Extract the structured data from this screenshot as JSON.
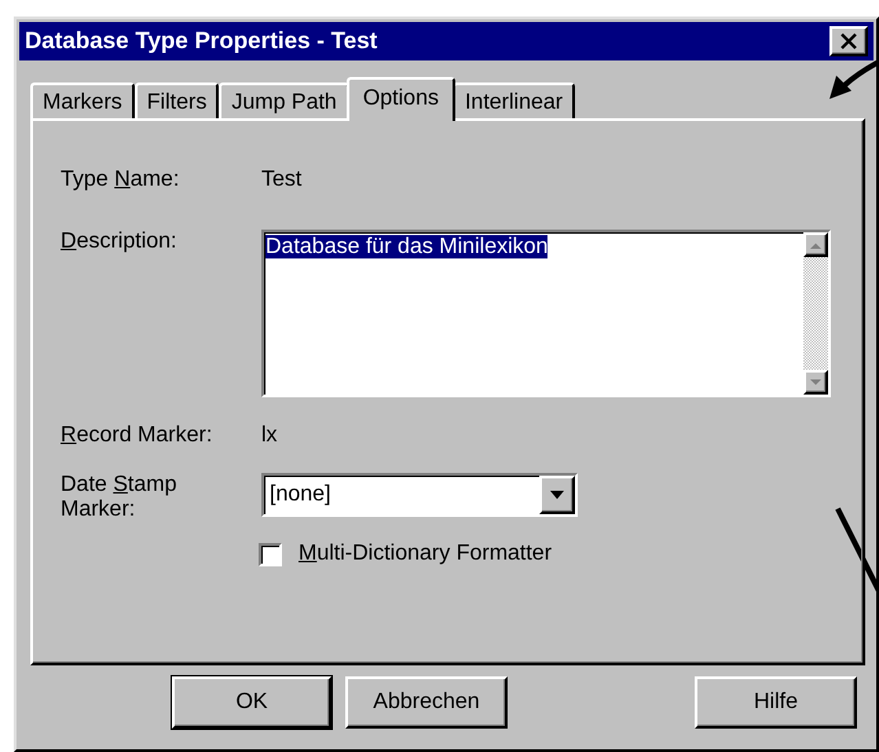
{
  "window": {
    "title": "Database Type Properties - Test"
  },
  "tabs": [
    {
      "label": "Markers",
      "selected": false
    },
    {
      "label": "Filters",
      "selected": false
    },
    {
      "label": "Jump Path",
      "selected": false
    },
    {
      "label": "Options",
      "selected": true
    },
    {
      "label": "Interlinear",
      "selected": false
    }
  ],
  "fields": [
    {
      "kind": "static",
      "label": {
        "before": "Type ",
        "key": "N",
        "after": "ame:"
      },
      "value": "Test"
    },
    {
      "kind": "textarea",
      "label": {
        "key": "D",
        "after": "escription:"
      },
      "value": "Database für das Minilexikon",
      "selected": true
    },
    {
      "kind": "static",
      "label": {
        "key": "R",
        "after": "ecord Marker:"
      },
      "value": "lx"
    },
    {
      "kind": "dropdown",
      "label": {
        "before": "Date ",
        "key": "S",
        "after": "tamp Marker:"
      },
      "value": "[none]"
    },
    {
      "kind": "checkbox",
      "label": {
        "key": "M",
        "after": "ulti-Dictionary Formatter"
      },
      "checked": false
    }
  ],
  "buttons": [
    {
      "label": "OK",
      "default": true
    },
    {
      "label": "Abbrechen",
      "default": false
    },
    {
      "label": "Hilfe",
      "default": false
    }
  ]
}
